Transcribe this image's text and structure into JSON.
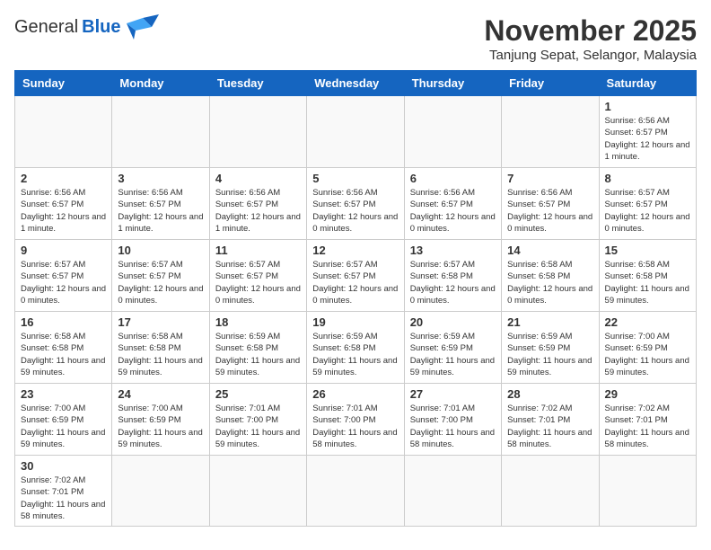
{
  "header": {
    "logo_general": "General",
    "logo_blue": "Blue",
    "month_title": "November 2025",
    "subtitle": "Tanjung Sepat, Selangor, Malaysia"
  },
  "days_of_week": [
    "Sunday",
    "Monday",
    "Tuesday",
    "Wednesday",
    "Thursday",
    "Friday",
    "Saturday"
  ],
  "weeks": [
    [
      {
        "day": "",
        "info": ""
      },
      {
        "day": "",
        "info": ""
      },
      {
        "day": "",
        "info": ""
      },
      {
        "day": "",
        "info": ""
      },
      {
        "day": "",
        "info": ""
      },
      {
        "day": "",
        "info": ""
      },
      {
        "day": "1",
        "info": "Sunrise: 6:56 AM\nSunset: 6:57 PM\nDaylight: 12 hours and 1 minute."
      }
    ],
    [
      {
        "day": "2",
        "info": "Sunrise: 6:56 AM\nSunset: 6:57 PM\nDaylight: 12 hours and 1 minute."
      },
      {
        "day": "3",
        "info": "Sunrise: 6:56 AM\nSunset: 6:57 PM\nDaylight: 12 hours and 1 minute."
      },
      {
        "day": "4",
        "info": "Sunrise: 6:56 AM\nSunset: 6:57 PM\nDaylight: 12 hours and 1 minute."
      },
      {
        "day": "5",
        "info": "Sunrise: 6:56 AM\nSunset: 6:57 PM\nDaylight: 12 hours and 0 minutes."
      },
      {
        "day": "6",
        "info": "Sunrise: 6:56 AM\nSunset: 6:57 PM\nDaylight: 12 hours and 0 minutes."
      },
      {
        "day": "7",
        "info": "Sunrise: 6:56 AM\nSunset: 6:57 PM\nDaylight: 12 hours and 0 minutes."
      },
      {
        "day": "8",
        "info": "Sunrise: 6:57 AM\nSunset: 6:57 PM\nDaylight: 12 hours and 0 minutes."
      }
    ],
    [
      {
        "day": "9",
        "info": "Sunrise: 6:57 AM\nSunset: 6:57 PM\nDaylight: 12 hours and 0 minutes."
      },
      {
        "day": "10",
        "info": "Sunrise: 6:57 AM\nSunset: 6:57 PM\nDaylight: 12 hours and 0 minutes."
      },
      {
        "day": "11",
        "info": "Sunrise: 6:57 AM\nSunset: 6:57 PM\nDaylight: 12 hours and 0 minutes."
      },
      {
        "day": "12",
        "info": "Sunrise: 6:57 AM\nSunset: 6:57 PM\nDaylight: 12 hours and 0 minutes."
      },
      {
        "day": "13",
        "info": "Sunrise: 6:57 AM\nSunset: 6:58 PM\nDaylight: 12 hours and 0 minutes."
      },
      {
        "day": "14",
        "info": "Sunrise: 6:58 AM\nSunset: 6:58 PM\nDaylight: 12 hours and 0 minutes."
      },
      {
        "day": "15",
        "info": "Sunrise: 6:58 AM\nSunset: 6:58 PM\nDaylight: 11 hours and 59 minutes."
      }
    ],
    [
      {
        "day": "16",
        "info": "Sunrise: 6:58 AM\nSunset: 6:58 PM\nDaylight: 11 hours and 59 minutes."
      },
      {
        "day": "17",
        "info": "Sunrise: 6:58 AM\nSunset: 6:58 PM\nDaylight: 11 hours and 59 minutes."
      },
      {
        "day": "18",
        "info": "Sunrise: 6:59 AM\nSunset: 6:58 PM\nDaylight: 11 hours and 59 minutes."
      },
      {
        "day": "19",
        "info": "Sunrise: 6:59 AM\nSunset: 6:58 PM\nDaylight: 11 hours and 59 minutes."
      },
      {
        "day": "20",
        "info": "Sunrise: 6:59 AM\nSunset: 6:59 PM\nDaylight: 11 hours and 59 minutes."
      },
      {
        "day": "21",
        "info": "Sunrise: 6:59 AM\nSunset: 6:59 PM\nDaylight: 11 hours and 59 minutes."
      },
      {
        "day": "22",
        "info": "Sunrise: 7:00 AM\nSunset: 6:59 PM\nDaylight: 11 hours and 59 minutes."
      }
    ],
    [
      {
        "day": "23",
        "info": "Sunrise: 7:00 AM\nSunset: 6:59 PM\nDaylight: 11 hours and 59 minutes."
      },
      {
        "day": "24",
        "info": "Sunrise: 7:00 AM\nSunset: 6:59 PM\nDaylight: 11 hours and 59 minutes."
      },
      {
        "day": "25",
        "info": "Sunrise: 7:01 AM\nSunset: 7:00 PM\nDaylight: 11 hours and 59 minutes."
      },
      {
        "day": "26",
        "info": "Sunrise: 7:01 AM\nSunset: 7:00 PM\nDaylight: 11 hours and 58 minutes."
      },
      {
        "day": "27",
        "info": "Sunrise: 7:01 AM\nSunset: 7:00 PM\nDaylight: 11 hours and 58 minutes."
      },
      {
        "day": "28",
        "info": "Sunrise: 7:02 AM\nSunset: 7:01 PM\nDaylight: 11 hours and 58 minutes."
      },
      {
        "day": "29",
        "info": "Sunrise: 7:02 AM\nSunset: 7:01 PM\nDaylight: 11 hours and 58 minutes."
      }
    ],
    [
      {
        "day": "30",
        "info": "Sunrise: 7:02 AM\nSunset: 7:01 PM\nDaylight: 11 hours and 58 minutes."
      },
      {
        "day": "",
        "info": ""
      },
      {
        "day": "",
        "info": ""
      },
      {
        "day": "",
        "info": ""
      },
      {
        "day": "",
        "info": ""
      },
      {
        "day": "",
        "info": ""
      },
      {
        "day": "",
        "info": ""
      }
    ]
  ]
}
